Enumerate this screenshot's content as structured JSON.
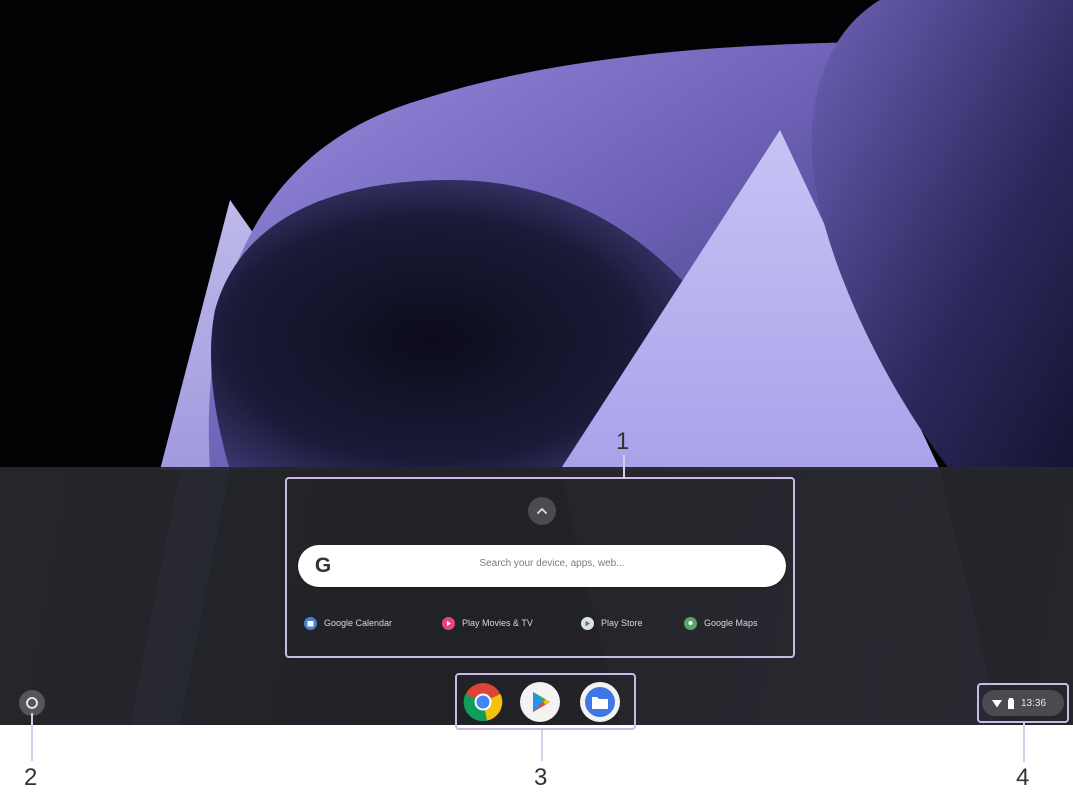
{
  "launcher": {
    "search_placeholder": "Search your device, apps, web...",
    "expand_icon": "chevron-up-icon",
    "suggestions": [
      {
        "label": "Google Calendar",
        "icon": "calendar-icon",
        "color": "#4a7fd8"
      },
      {
        "label": "Play Movies & TV",
        "icon": "play-movies-icon",
        "color": "#e8447a"
      },
      {
        "label": "Play Store",
        "icon": "play-store-icon",
        "color": "#e0e0e0"
      },
      {
        "label": "Google Maps",
        "icon": "maps-icon",
        "color": "#5aa469"
      }
    ]
  },
  "shelf": {
    "launcher_icon": "launcher-circle-icon",
    "apps": [
      {
        "name": "Chrome",
        "icon": "chrome-icon"
      },
      {
        "name": "Play Store",
        "icon": "play-store-icon"
      },
      {
        "name": "Files",
        "icon": "files-icon"
      }
    ]
  },
  "status": {
    "time": "13:36",
    "icons": [
      "wifi-icon",
      "battery-icon"
    ]
  },
  "callouts": {
    "one": "1",
    "two": "2",
    "three": "3",
    "four": "4"
  },
  "colors": {
    "callout_border": "#c9b8e8",
    "launcher_bg": "#28292e",
    "wallpaper_purple": "#8f84d6"
  }
}
